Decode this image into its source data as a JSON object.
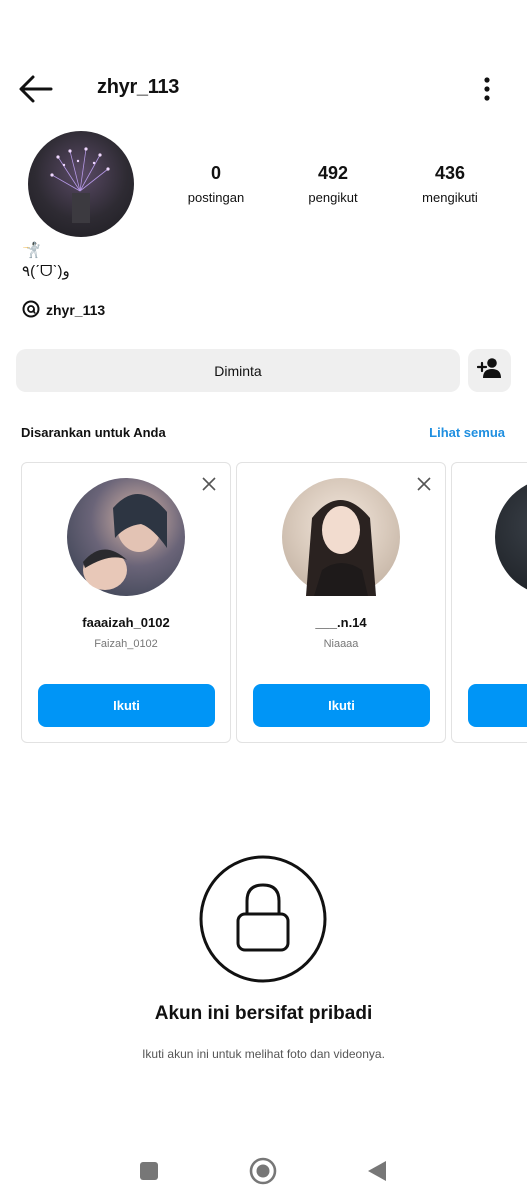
{
  "header": {
    "username": "zhyr_113"
  },
  "profile": {
    "stats": [
      {
        "value": "0",
        "label": "postingan"
      },
      {
        "value": "492",
        "label": "pengikut"
      },
      {
        "value": "436",
        "label": "mengikuti"
      }
    ],
    "bio_line1": "🤺",
    "bio_line2": "٩(ˊᗜˋ)و",
    "threads_handle": "zhyr_113"
  },
  "actions": {
    "requested_label": "Diminta"
  },
  "suggestions": {
    "title": "Disarankan untuk Anda",
    "see_all": "Lihat semua",
    "cards": [
      {
        "username": "faaaizah_0102",
        "name": "Faizah_0102",
        "button": "Ikuti"
      },
      {
        "username": "___.n.14",
        "name": "Niaaaa",
        "button": "Ikuti"
      }
    ]
  },
  "private": {
    "title": "Akun ini bersifat pribadi",
    "subtitle": "Ikuti akun ini untuk melihat foto dan videonya."
  },
  "colors": {
    "accent": "#0095f6",
    "link": "#1f8fe0",
    "button_bg": "#efefef"
  }
}
